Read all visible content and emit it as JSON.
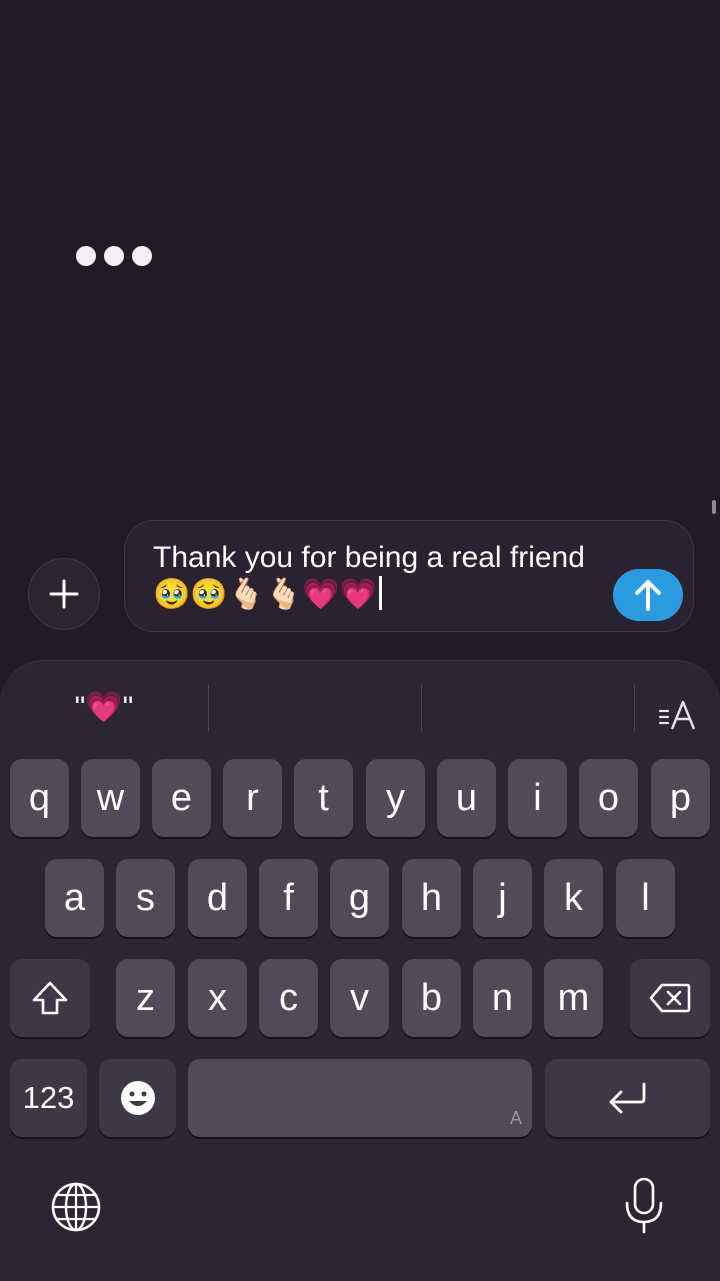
{
  "conversation": {
    "typing_indicator_dots": 3
  },
  "composer": {
    "message_text": "Thank you for being a real friend🥹🥹🫰🏻🫰🏻💗💗",
    "plus_icon": "plus-icon",
    "send_icon": "arrow-up-icon",
    "send_color": "#2a9be0"
  },
  "keyboard": {
    "suggestions": [
      "\"💗\"",
      "",
      ""
    ],
    "writing_tools_icon": "text-format-icon",
    "rows": [
      [
        "q",
        "w",
        "e",
        "r",
        "t",
        "y",
        "u",
        "i",
        "o",
        "p"
      ],
      [
        "a",
        "s",
        "d",
        "f",
        "g",
        "h",
        "j",
        "k",
        "l"
      ],
      [
        "z",
        "x",
        "c",
        "v",
        "b",
        "n",
        "m"
      ]
    ],
    "numbers_label": "123",
    "space_hint": "A",
    "shift_icon": "shift-icon",
    "delete_icon": "delete-icon",
    "emoji_icon": "emoji-icon",
    "return_icon": "return-icon",
    "globe_icon": "globe-icon",
    "mic_icon": "microphone-icon"
  }
}
